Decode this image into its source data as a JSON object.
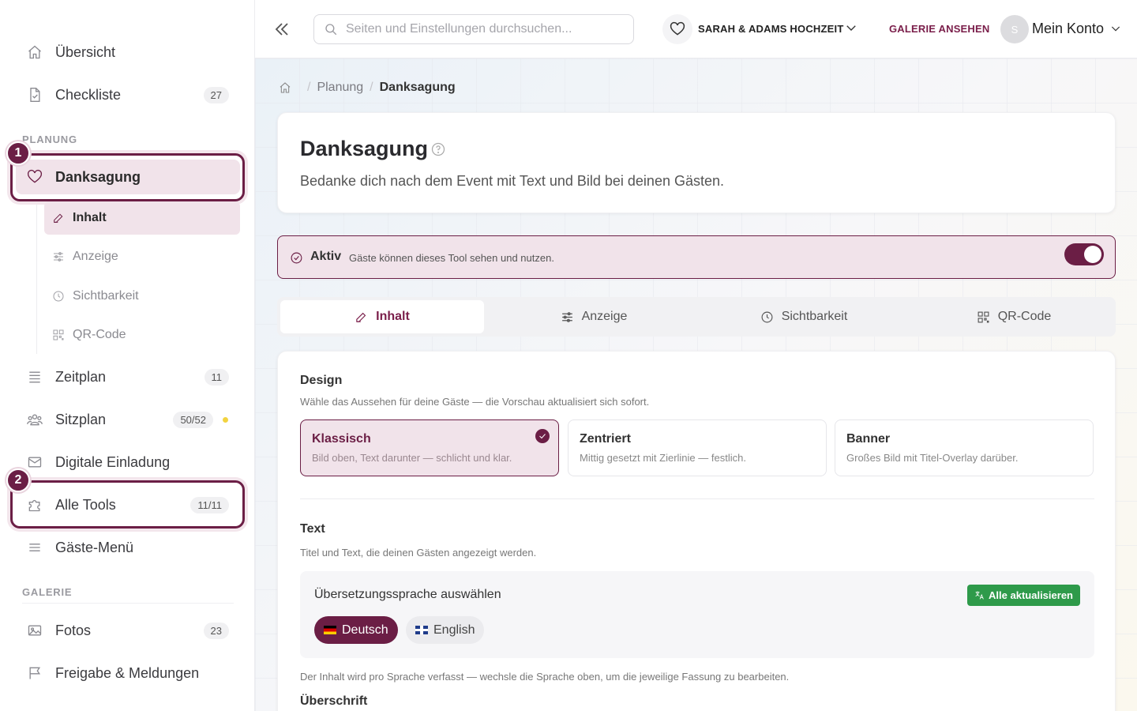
{
  "sidebar": {
    "items": {
      "overview": {
        "label": "Übersicht"
      },
      "checklist": {
        "label": "Checkliste",
        "badge": "27"
      },
      "thanks": {
        "label": "Danksagung"
      },
      "timeline": {
        "label": "Zeitplan",
        "badge": "11"
      },
      "seating": {
        "label": "Sitzplan",
        "badge": "50/52"
      },
      "invitation": {
        "label": "Digitale Einladung"
      },
      "tools": {
        "label": "Alle Tools",
        "badge": "11/11"
      },
      "guestmenu": {
        "label": "Gäste-Menü"
      },
      "photos": {
        "label": "Fotos",
        "badge": "23"
      },
      "sharing": {
        "label": "Freigabe & Meldungen"
      }
    },
    "sections": {
      "planning": "PLANUNG",
      "gallery": "GALERIE"
    },
    "sub_items": {
      "content": "Inhalt",
      "display": "Anzeige",
      "visibility": "Sichtbarkeit",
      "qrcode": "QR-Code"
    },
    "markers": {
      "first": "1",
      "second": "2"
    }
  },
  "header": {
    "search_placeholder": "Seiten und Einstellungen durchsuchen...",
    "event_name": "SARAH & ADAMS HOCHZEIT",
    "gallery_link": "GALERIE ANSEHEN",
    "avatar_initial": "S",
    "account_label": "Mein Konto"
  },
  "breadcrumb": {
    "parent": "Planung",
    "current": "Danksagung"
  },
  "page": {
    "title": "Danksagung",
    "subtitle": "Bedanke dich nach dem Event mit Text und Bild bei deinen Gästen."
  },
  "status": {
    "label": "Aktiv",
    "description": "Gäste können dieses Tool sehen und nutzen.",
    "enabled": true
  },
  "tabs": {
    "content": "Inhalt",
    "display": "Anzeige",
    "visibility": "Sichtbarkeit",
    "qrcode": "QR-Code"
  },
  "design": {
    "title": "Design",
    "subtitle": "Wähle das Aussehen für deine Gäste — die Vorschau aktualisiert sich sofort.",
    "options": {
      "classic": {
        "title": "Klassisch",
        "desc": "Bild oben, Text darunter — schlicht und klar."
      },
      "centered": {
        "title": "Zentriert",
        "desc": "Mittig gesetzt mit Zierlinie — festlich."
      },
      "banner": {
        "title": "Banner",
        "desc": "Großes Bild mit Titel-Overlay darüber."
      }
    }
  },
  "text_section": {
    "title": "Text",
    "subtitle": "Titel und Text, die deinen Gästen angezeigt werden.",
    "language_title": "Übersetzungssprache auswählen",
    "update_all": "Alle aktualisieren",
    "languages": {
      "de": "Deutsch",
      "en": "English"
    },
    "note": "Der Inhalt wird pro Sprache verfasst — wechsle die Sprache oben, um die jeweilige Fassung zu bearbeiten.",
    "heading_label": "Überschrift"
  },
  "colors": {
    "accent": "#6b1e45",
    "success": "#2e9a4a"
  }
}
